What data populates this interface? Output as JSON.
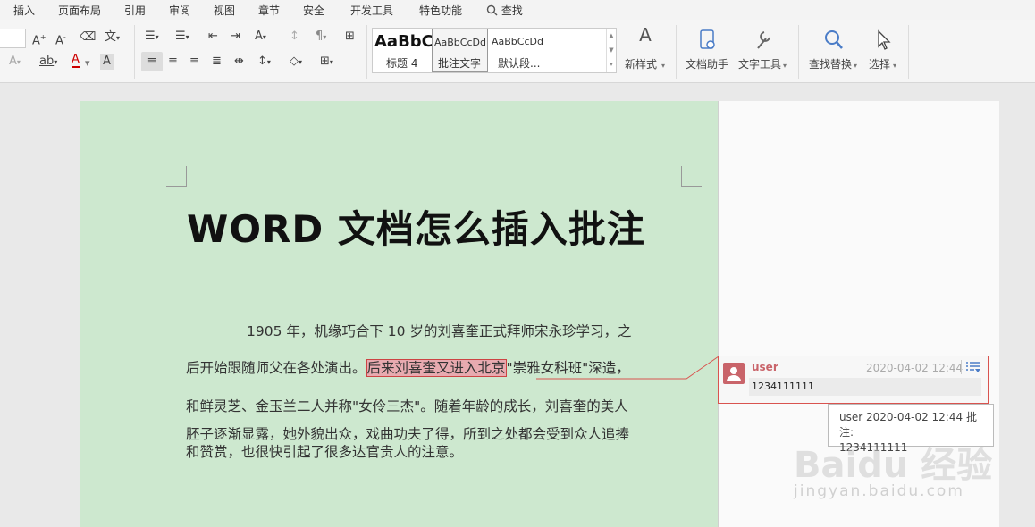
{
  "menu": {
    "items": [
      "插入",
      "页面布局",
      "引用",
      "审阅",
      "视图",
      "章节",
      "安全",
      "开发工具",
      "特色功能"
    ],
    "search_label": "查找"
  },
  "ribbon": {
    "styles": [
      {
        "preview": "AaBbC",
        "name": "标题 4"
      },
      {
        "preview": "AaBbCcDd",
        "name": "批注文字"
      },
      {
        "preview": "AaBbCcDd",
        "name": "默认段..."
      }
    ],
    "new_style": "新样式",
    "doc_assistant": "文档助手",
    "text_tools": "文字工具",
    "find_replace": "查找替换",
    "select": "选择"
  },
  "document": {
    "title": "WORD 文档怎么插入批注",
    "line1": "1905 年，机缘巧合下 10 岁的刘喜奎正式拜师宋永珍学习，之",
    "line2_pre": "后开始跟随师父在各处演出。",
    "line2_highlight": "后来刘喜奎又进入北京",
    "line2_post": "\"崇雅女科班\"深造，",
    "line3": "和鲜灵芝、金玉兰二人并称\"女伶三杰\"。随着年龄的成长，刘喜奎的美人",
    "line4": "胚子逐渐显露，她外貌出众，戏曲功夫了得，所到之处都会受到众人追捧",
    "line5": "和赞赏，也很快引起了很多达官贵人的注意。"
  },
  "comment": {
    "user": "user",
    "date": "2020-04-02 12:44",
    "text": "1234111111",
    "tooltip_line1": "user 2020-04-02 12:44 批注:",
    "tooltip_line2": "1234111111"
  },
  "watermark": {
    "logo": "Baidu 经验",
    "url": "jingyan.baidu.com"
  },
  "colors": {
    "page_bg": "#cde8cf",
    "highlight": "#e8aab0",
    "comment_border": "#d9534f",
    "avatar": "#c9646a"
  }
}
